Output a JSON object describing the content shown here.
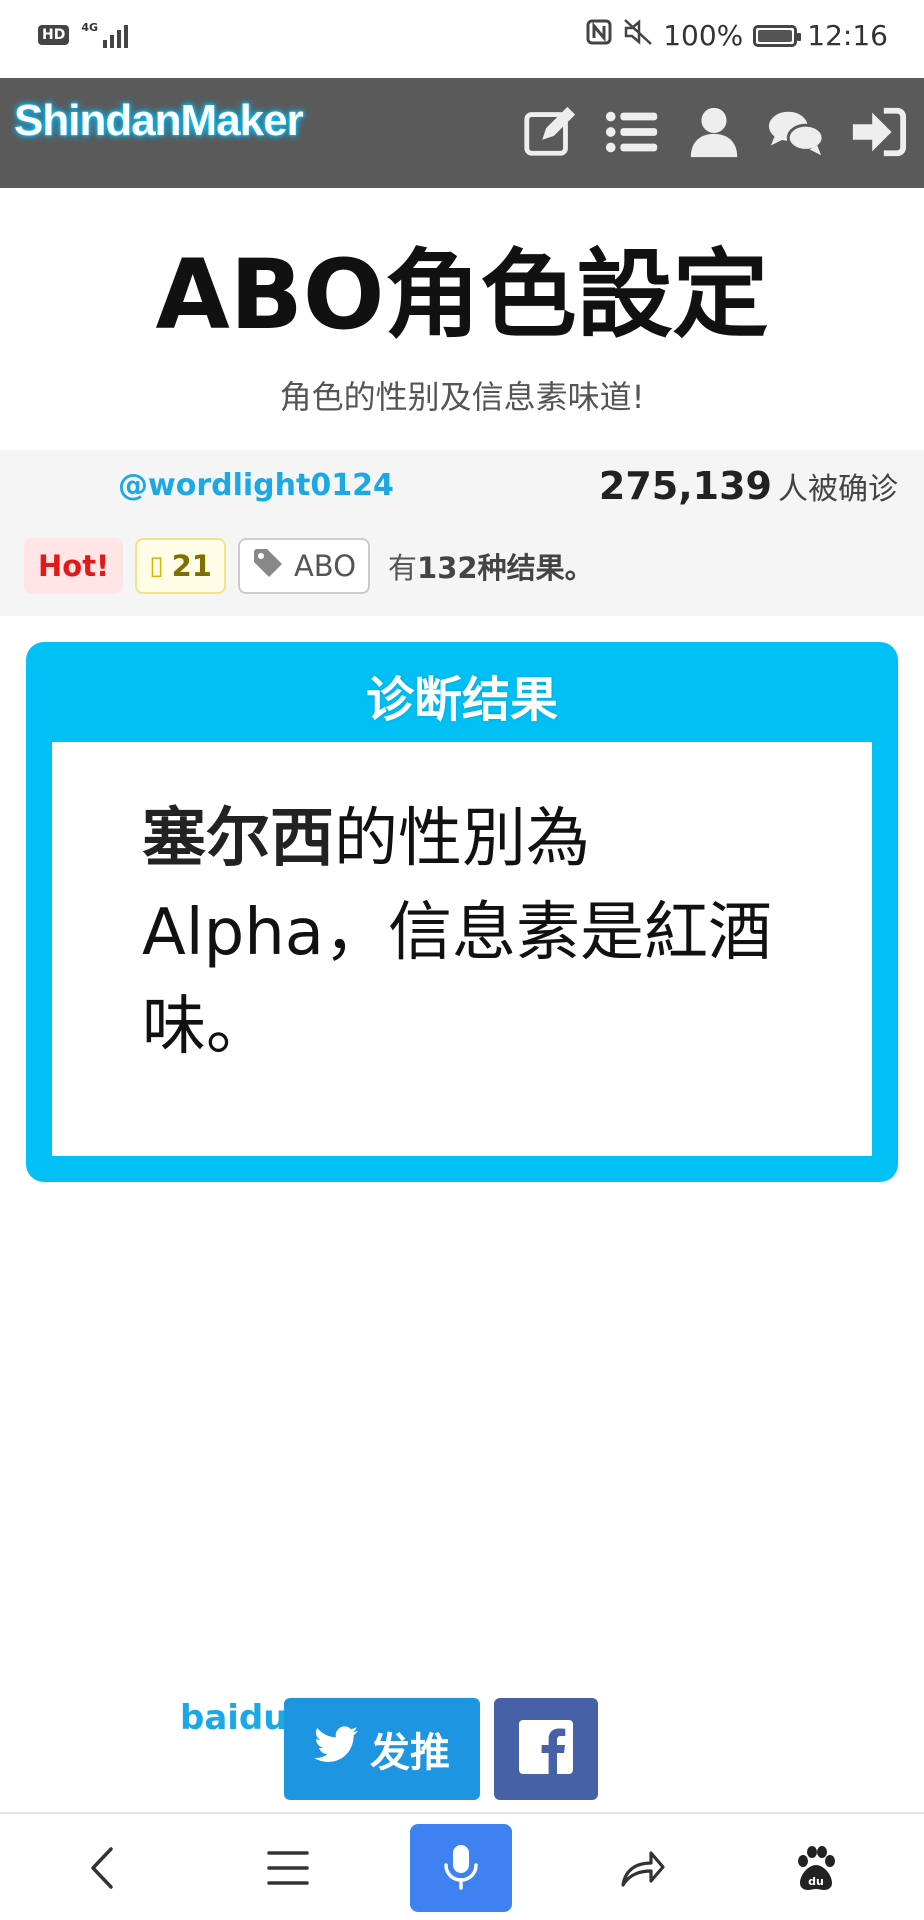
{
  "status_bar": {
    "left_badge": "HD",
    "network": "4G",
    "battery_percent": "100%",
    "battery_level": 1.0,
    "time": "12:16"
  },
  "header": {
    "logo": "ShindanMaker",
    "icons": [
      "edit-icon",
      "list-icon",
      "user-icon",
      "chat-icon",
      "login-icon"
    ]
  },
  "page": {
    "title": "ABO角色設定",
    "subtitle": "角色的性别及信息素味道!",
    "author": "@wordlight0124",
    "count_number": "275,139",
    "count_suffix": "人被确诊",
    "tags": {
      "hot": "Hot!",
      "favorites": "21",
      "topic": "ABO"
    },
    "results_prefix": "有",
    "results_count": "132种结果。"
  },
  "result": {
    "heading": "诊断结果",
    "name": "塞尔西",
    "text": "的性別為Alpha，信息素是紅酒味。"
  },
  "share": {
    "baidu_label": "baidu",
    "tweet_label": "发推"
  },
  "bottom_nav": {
    "icons": [
      "back-icon",
      "menu-icon",
      "mic-icon",
      "share-icon",
      "baidu-paw-icon"
    ]
  },
  "colors": {
    "header_bg": "#5a5a5a",
    "accent": "#00c0f5",
    "link": "#1aa9e6",
    "twitter": "#1e95e0",
    "facebook": "#4661a8",
    "mic": "#3d82f0"
  }
}
